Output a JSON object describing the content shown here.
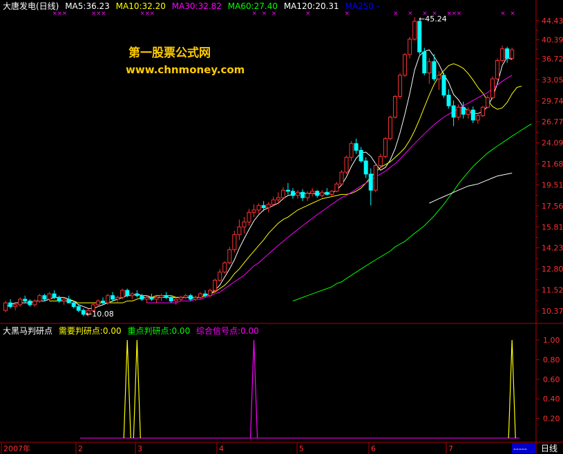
{
  "header": {
    "stock": "大唐发电(日线)",
    "ma": [
      {
        "text": "MA5:36.23",
        "color": "#ffffff"
      },
      {
        "text": "MA10:32.20",
        "color": "#ffff00"
      },
      {
        "text": "MA30:32.82",
        "color": "#ff00ff"
      },
      {
        "text": "MA60:27.40",
        "color": "#00ff00"
      },
      {
        "text": "MA120:20.31",
        "color": "#ffffff"
      },
      {
        "text": "MA250 -",
        "color": "#0000ff"
      }
    ]
  },
  "watermark": {
    "line1": "第一股票公式网",
    "line2": "www.chnmoney.com"
  },
  "indicator": {
    "title": "大黑马判研点",
    "items": [
      {
        "text": "需要判研点:0.00",
        "color": "#ffff00"
      },
      {
        "text": "重点判研点:0.00",
        "color": "#00ff00"
      },
      {
        "text": "综合信号点:0.00",
        "color": "#ff00ff"
      }
    ]
  },
  "period_button": "日线",
  "indicator_button": "-----",
  "colors": {
    "up": "#ff3333",
    "down": "#00ffff",
    "axis": "#b00000",
    "grid": "#7a0000"
  },
  "chart_data": {
    "type": "candlestick",
    "price_ticks": [
      "44.43",
      "40.39",
      "36.72",
      "33.05",
      "29.74",
      "26.77",
      "24.09",
      "21.68",
      "19.51",
      "17.56",
      "15.81",
      "14.23",
      "12.80",
      "11.52",
      "10.37"
    ],
    "price_scale": "log",
    "annotations": {
      "high": "45.24",
      "low": "10.08"
    },
    "x_labels": [
      "2007年",
      "2",
      "3",
      "4",
      "5",
      "6",
      "7"
    ],
    "candles": [
      [
        10.4,
        10.9,
        10.3,
        10.8
      ],
      [
        10.8,
        11.0,
        10.5,
        10.6
      ],
      [
        10.6,
        10.8,
        10.4,
        10.7
      ],
      [
        10.7,
        11.1,
        10.6,
        11.0
      ],
      [
        11.0,
        11.2,
        10.8,
        10.9
      ],
      [
        10.9,
        11.0,
        10.6,
        10.7
      ],
      [
        10.7,
        11.0,
        10.6,
        10.9
      ],
      [
        10.9,
        11.3,
        10.8,
        11.2
      ],
      [
        11.2,
        11.3,
        10.9,
        11.0
      ],
      [
        11.0,
        11.4,
        10.9,
        11.3
      ],
      [
        11.3,
        11.5,
        11.0,
        11.1
      ],
      [
        11.1,
        11.2,
        10.8,
        10.9
      ],
      [
        10.9,
        11.1,
        10.7,
        11.0
      ],
      [
        11.0,
        11.2,
        10.8,
        10.8
      ],
      [
        10.8,
        10.9,
        10.5,
        10.6
      ],
      [
        10.6,
        10.7,
        10.3,
        10.4
      ],
      [
        10.4,
        10.5,
        10.1,
        10.2
      ],
      [
        10.2,
        10.5,
        10.08,
        10.4
      ],
      [
        10.4,
        10.8,
        10.3,
        10.7
      ],
      [
        10.7,
        11.0,
        10.6,
        10.9
      ],
      [
        10.9,
        11.1,
        10.7,
        10.8
      ],
      [
        10.8,
        11.3,
        10.7,
        11.2
      ],
      [
        11.2,
        11.4,
        10.9,
        11.0
      ],
      [
        11.0,
        11.2,
        10.8,
        11.1
      ],
      [
        11.1,
        11.6,
        11.0,
        11.5
      ],
      [
        11.5,
        11.6,
        11.1,
        11.2
      ],
      [
        11.2,
        11.4,
        11.0,
        11.3
      ],
      [
        11.3,
        11.5,
        11.1,
        11.2
      ],
      [
        11.2,
        11.3,
        10.9,
        11.0
      ],
      [
        11.0,
        11.2,
        10.8,
        11.1
      ],
      [
        11.1,
        11.3,
        10.9,
        11.0
      ],
      [
        11.0,
        11.2,
        10.8,
        11.1
      ],
      [
        11.1,
        11.3,
        10.9,
        11.2
      ],
      [
        11.2,
        11.4,
        11.0,
        11.1
      ],
      [
        11.1,
        11.2,
        10.8,
        10.9
      ],
      [
        10.9,
        11.1,
        10.7,
        11.0
      ],
      [
        11.0,
        11.2,
        10.9,
        11.1
      ],
      [
        11.1,
        11.3,
        11.0,
        11.2
      ],
      [
        11.2,
        11.3,
        10.9,
        11.0
      ],
      [
        11.0,
        11.2,
        10.9,
        11.1
      ],
      [
        11.1,
        11.4,
        11.0,
        11.3
      ],
      [
        11.3,
        11.5,
        11.1,
        11.2
      ],
      [
        11.2,
        11.6,
        11.1,
        11.5
      ],
      [
        11.5,
        12.2,
        11.4,
        12.1
      ],
      [
        12.1,
        12.8,
        12.0,
        12.6
      ],
      [
        12.6,
        13.3,
        12.5,
        13.2
      ],
      [
        13.2,
        14.3,
        13.1,
        14.1
      ],
      [
        14.1,
        15.5,
        13.9,
        15.2
      ],
      [
        15.2,
        16.4,
        14.8,
        15.8
      ],
      [
        15.8,
        16.6,
        15.3,
        16.2
      ],
      [
        16.2,
        17.3,
        15.9,
        17.0
      ],
      [
        17.0,
        17.7,
        16.6,
        17.2
      ],
      [
        17.2,
        17.8,
        16.9,
        17.6
      ],
      [
        17.6,
        18.0,
        17.1,
        17.4
      ],
      [
        17.4,
        17.9,
        17.0,
        17.7
      ],
      [
        17.7,
        18.4,
        17.5,
        18.1
      ],
      [
        18.1,
        18.8,
        17.7,
        18.3
      ],
      [
        18.3,
        19.3,
        18.1,
        19.0
      ],
      [
        19.0,
        19.7,
        18.6,
        18.9
      ],
      [
        18.9,
        19.2,
        18.2,
        18.5
      ],
      [
        18.5,
        19.0,
        18.2,
        18.8
      ],
      [
        18.8,
        19.1,
        18.0,
        18.3
      ],
      [
        18.3,
        18.9,
        18.0,
        18.7
      ],
      [
        18.7,
        19.2,
        18.4,
        18.9
      ],
      [
        18.9,
        19.0,
        18.3,
        18.5
      ],
      [
        18.5,
        19.0,
        18.3,
        18.8
      ],
      [
        18.8,
        19.2,
        18.5,
        18.6
      ],
      [
        18.6,
        19.0,
        18.4,
        18.9
      ],
      [
        18.9,
        19.8,
        18.8,
        19.6
      ],
      [
        19.6,
        21.0,
        19.4,
        20.8
      ],
      [
        20.8,
        22.6,
        20.6,
        22.4
      ],
      [
        22.4,
        24.3,
        22.0,
        24.0
      ],
      [
        24.0,
        24.6,
        22.8,
        23.2
      ],
      [
        23.2,
        23.6,
        21.8,
        22.0
      ],
      [
        22.0,
        22.4,
        20.2,
        20.6
      ],
      [
        20.6,
        21.2,
        17.6,
        19.0
      ],
      [
        19.0,
        21.8,
        18.8,
        21.5
      ],
      [
        21.5,
        22.8,
        21.2,
        22.5
      ],
      [
        22.5,
        24.8,
        22.3,
        24.6
      ],
      [
        24.6,
        27.6,
        24.4,
        27.4
      ],
      [
        27.4,
        30.6,
        27.2,
        30.4
      ],
      [
        30.4,
        34.2,
        30.0,
        33.8
      ],
      [
        33.8,
        37.8,
        33.5,
        37.5
      ],
      [
        37.5,
        41.0,
        36.8,
        40.5
      ],
      [
        40.5,
        45.24,
        40.2,
        44.3
      ],
      [
        44.3,
        44.5,
        37.5,
        38.0
      ],
      [
        38.0,
        38.8,
        33.8,
        34.2
      ],
      [
        34.2,
        36.8,
        32.4,
        36.2
      ],
      [
        36.2,
        37.6,
        32.8,
        33.2
      ],
      [
        33.2,
        34.5,
        31.4,
        33.8
      ],
      [
        33.8,
        34.2,
        30.2,
        30.6
      ],
      [
        30.6,
        31.5,
        28.6,
        29.0
      ],
      [
        29.0,
        29.8,
        26.2,
        27.4
      ],
      [
        27.4,
        29.2,
        27.0,
        28.8
      ],
      [
        28.8,
        29.6,
        27.2,
        27.8
      ],
      [
        27.8,
        28.8,
        27.2,
        28.4
      ],
      [
        28.4,
        28.9,
        26.6,
        27.0
      ],
      [
        27.0,
        28.0,
        26.5,
        27.6
      ],
      [
        27.6,
        29.0,
        27.4,
        28.8
      ],
      [
        28.8,
        30.6,
        28.6,
        30.2
      ],
      [
        30.2,
        33.6,
        30.0,
        33.2
      ],
      [
        33.2,
        36.8,
        33.0,
        36.4
      ],
      [
        36.4,
        39.2,
        36.0,
        38.6
      ],
      [
        38.6,
        39.0,
        36.0,
        36.8
      ],
      [
        36.8,
        38.8,
        36.5,
        38.4
      ]
    ],
    "series": [
      {
        "name": "MA5",
        "color": "#ffffff",
        "start": 0,
        "values": [
          10.6,
          10.7,
          10.8,
          10.8,
          10.8,
          10.8,
          10.9,
          10.9,
          10.9,
          11.0,
          11.1,
          11.1,
          11.1,
          11.0,
          10.9,
          10.7,
          10.6,
          10.5,
          10.5,
          10.6,
          10.7,
          10.8,
          10.9,
          11.0,
          11.1,
          11.2,
          11.2,
          11.3,
          11.2,
          11.2,
          11.1,
          11.1,
          11.1,
          11.1,
          11.1,
          11.1,
          11.1,
          11.1,
          11.1,
          11.1,
          11.1,
          11.2,
          11.3,
          11.5,
          11.8,
          12.3,
          12.8,
          13.4,
          14.2,
          14.9,
          15.6,
          16.3,
          16.8,
          17.2,
          17.4,
          17.6,
          17.8,
          18.2,
          18.5,
          18.6,
          18.7,
          18.7,
          18.7,
          18.7,
          18.6,
          18.7,
          18.7,
          18.7,
          19.0,
          19.5,
          20.3,
          21.4,
          22.3,
          22.9,
          23.0,
          22.5,
          21.7,
          21.0,
          21.3,
          22.1,
          23.4,
          25.3,
          27.8,
          30.8,
          34.7,
          37.3,
          38.1,
          38.4,
          37.1,
          35.7,
          33.9,
          32.6,
          30.7,
          29.9,
          28.8,
          28.3,
          27.9,
          27.9,
          28.2,
          28.9,
          30.3,
          32.4,
          35.5,
          37.0,
          36.6
        ]
      },
      {
        "name": "MA10",
        "color": "#ffff00",
        "start": 9,
        "values": [
          10.9,
          10.9,
          10.9,
          10.9,
          10.9,
          10.9,
          10.8,
          10.8,
          10.8,
          10.8,
          10.8,
          10.8,
          10.8,
          10.8,
          10.8,
          10.8,
          10.9,
          10.9,
          11.0,
          11.1,
          11.1,
          11.1,
          11.2,
          11.2,
          11.2,
          11.2,
          11.1,
          11.1,
          11.1,
          11.1,
          11.1,
          11.1,
          11.2,
          11.3,
          11.4,
          11.6,
          11.8,
          12.1,
          12.5,
          12.8,
          13.2,
          13.6,
          14.0,
          14.4,
          14.8,
          15.3,
          15.7,
          16.1,
          16.4,
          16.6,
          16.9,
          17.2,
          17.4,
          17.6,
          17.8,
          18.0,
          18.2,
          18.3,
          18.4,
          18.5,
          18.6,
          18.6,
          18.7,
          18.9,
          19.2,
          19.7,
          20.3,
          20.8,
          21.3,
          21.6,
          21.9,
          22.4,
          22.9,
          23.5,
          24.4,
          25.6,
          27.1,
          28.8,
          30.6,
          32.3,
          33.6,
          34.6,
          35.5,
          35.8,
          35.5,
          35.0,
          34.1,
          33.0,
          31.8,
          30.9,
          29.8,
          28.9,
          28.5,
          28.7,
          29.5,
          30.8,
          31.8,
          32.0
        ]
      },
      {
        "name": "MA30",
        "color": "#ff00ff",
        "start": 29,
        "values": [
          10.8,
          10.8,
          10.8,
          10.8,
          10.8,
          10.8,
          10.8,
          10.9,
          10.9,
          10.9,
          11.0,
          11.0,
          11.1,
          11.2,
          11.3,
          11.4,
          11.6,
          11.8,
          12.0,
          12.2,
          12.4,
          12.7,
          13.0,
          13.2,
          13.5,
          13.8,
          14.1,
          14.4,
          14.7,
          15.0,
          15.3,
          15.6,
          15.9,
          16.2,
          16.5,
          16.8,
          17.1,
          17.4,
          17.7,
          18.0,
          18.3,
          18.5,
          18.8,
          19.1,
          19.4,
          19.7,
          20.0,
          20.3,
          20.6,
          20.9,
          21.3,
          21.7,
          22.2,
          22.8,
          23.4,
          24.0,
          24.6,
          25.2,
          25.8,
          26.4,
          26.9,
          27.4,
          27.8,
          28.2,
          28.6,
          29.0,
          29.4,
          29.8,
          30.2,
          30.6,
          31.0,
          31.6,
          32.2,
          32.8,
          33.3,
          33.8
        ]
      },
      {
        "name": "MA60",
        "color": "#00ff00",
        "start": 59,
        "values": [
          10.9,
          11.0,
          11.1,
          11.2,
          11.3,
          11.4,
          11.5,
          11.6,
          11.7,
          11.9,
          12.0,
          12.2,
          12.4,
          12.6,
          12.8,
          13.0,
          13.2,
          13.4,
          13.6,
          13.8,
          14.0,
          14.3,
          14.5,
          14.7,
          15.0,
          15.3,
          15.6,
          15.9,
          16.3,
          16.7,
          17.2,
          17.7,
          18.3,
          18.9,
          19.6,
          20.2,
          20.8,
          21.4,
          21.9,
          22.4,
          22.9,
          23.3,
          23.7,
          24.1,
          24.5,
          24.9,
          25.3,
          25.7,
          26.1,
          26.5
        ]
      },
      {
        "name": "MA120",
        "color": "#ffffff",
        "start": 87,
        "values": [
          17.8,
          18.0,
          18.2,
          18.4,
          18.6,
          18.8,
          19.0,
          19.2,
          19.4,
          19.5,
          19.6,
          19.8,
          20.0,
          20.2,
          20.4,
          20.5,
          20.6,
          20.7
        ]
      }
    ],
    "signals": [
      {
        "name": "需要判研点",
        "color": "#ffff00",
        "days": [
          25,
          27,
          104
        ]
      },
      {
        "name": "综合信号点",
        "color": "#ff00ff",
        "days": [
          51
        ]
      }
    ],
    "signal_ticks": [
      "1.00",
      "0.80",
      "0.60",
      "0.40",
      "0.20"
    ],
    "signal_range": [
      0,
      1
    ]
  }
}
